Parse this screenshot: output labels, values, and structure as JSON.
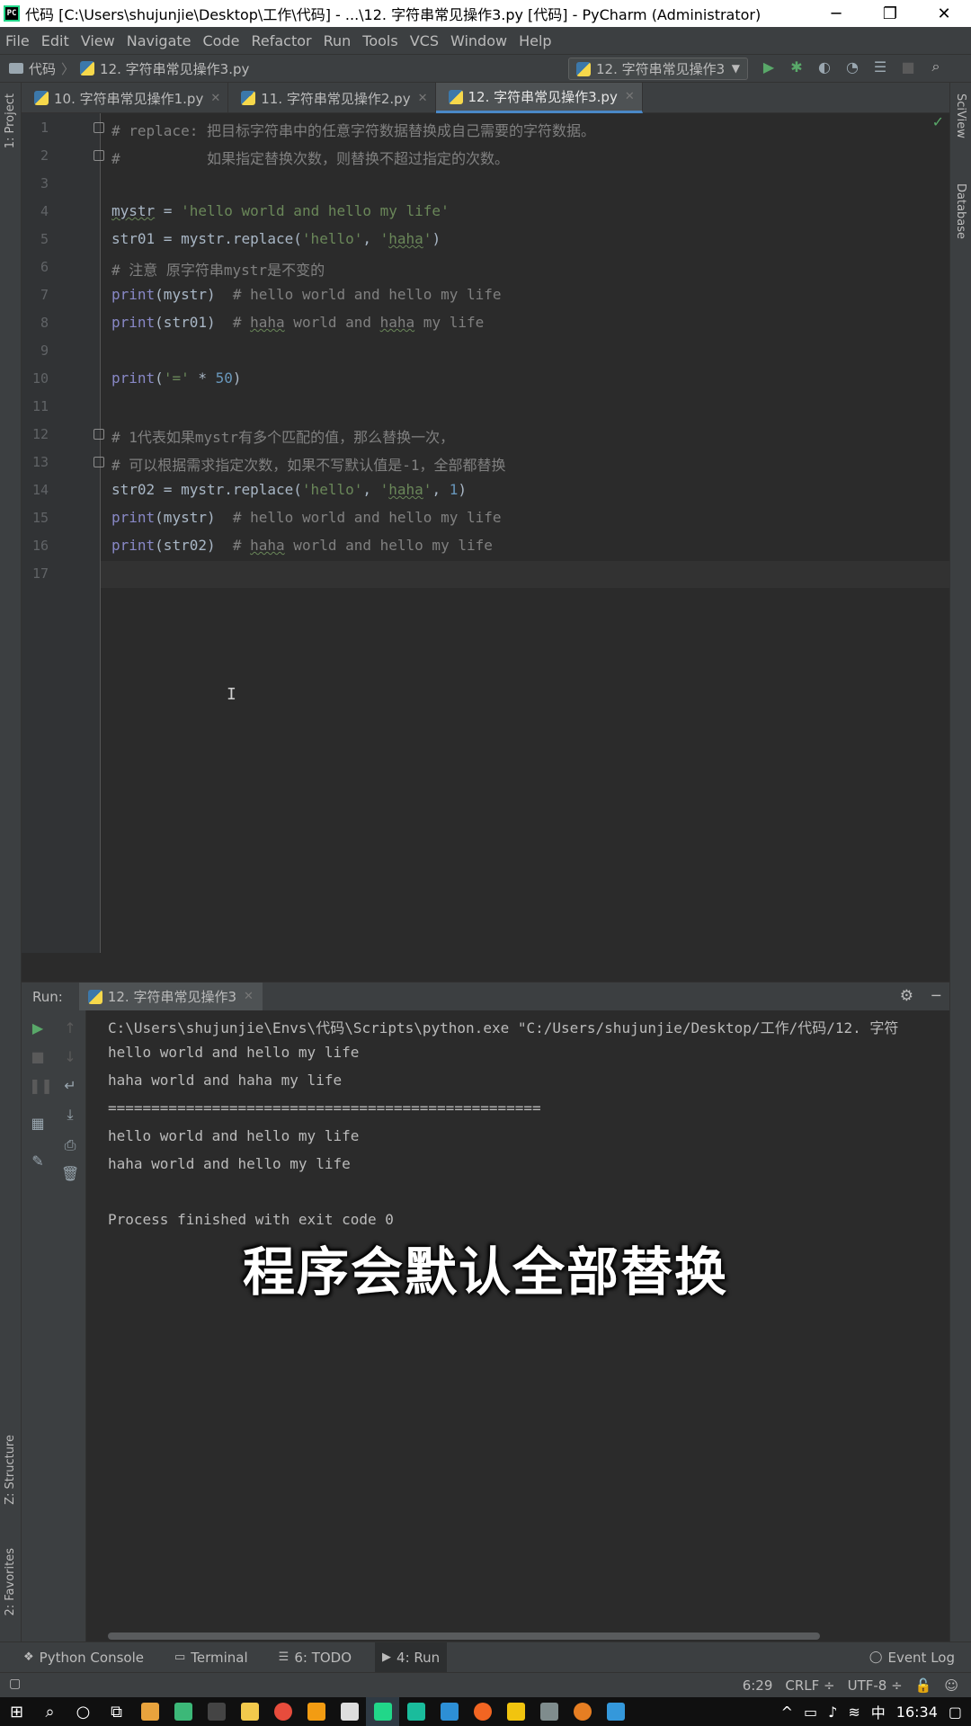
{
  "window": {
    "app_icon": "PC",
    "title": "代码 [C:\\Users\\shujunjie\\Desktop\\工作\\代码] - ...\\12. 字符串常见操作3.py [代码] - PyCharm (Administrator)",
    "minimize": "─",
    "maximize": "❐",
    "close": "✕"
  },
  "menu": [
    "File",
    "Edit",
    "View",
    "Navigate",
    "Code",
    "Refactor",
    "Run",
    "Tools",
    "VCS",
    "Window",
    "Help"
  ],
  "breadcrumb": {
    "project": "代码",
    "file": "12. 字符串常见操作3.py",
    "sep": "〉"
  },
  "run_config": {
    "name": "12. 字符串常见操作3",
    "caret": "▼"
  },
  "toolbar_icons": [
    "play-icon",
    "debug-icon",
    "coverage-icon",
    "profile-icon",
    "build-icon",
    "stop-icon",
    "search-icon"
  ],
  "side_labels": {
    "left_top": "1: Project",
    "left_struct": "Z: Structure",
    "left_fav": "2: Favorites",
    "right_sciview": "SciView",
    "right_db": "Database"
  },
  "tabs": [
    {
      "label": "10. 字符串常见操作1.py",
      "close": "✕"
    },
    {
      "label": "11. 字符串常见操作2.py",
      "close": "✕"
    },
    {
      "label": "12. 字符串常见操作3.py",
      "close": "✕"
    }
  ],
  "editor": {
    "line_numbers": [
      "1",
      "2",
      "3",
      "4",
      "5",
      "6",
      "7",
      "8",
      "9",
      "10",
      "11",
      "12",
      "13",
      "14",
      "15",
      "16",
      "17"
    ],
    "check": "✓",
    "cursor_glyph": "I"
  },
  "code": {
    "l1": "# replace: 把目标字符串中的任意字符数据替换成自己需要的字符数据。",
    "l2": "#          如果指定替换次数，则替换不超过指定的次数。",
    "l4_var": "mystr",
    "l4_eq": " = ",
    "l4_str": "'hello world and hello my life'",
    "l5_pre": "str01 = mystr.replace(",
    "l5_s1": "'hello'",
    "l5_comma": ", ",
    "l5_s2a": "'",
    "l5_s2b": "haha",
    "l5_s2c": "'",
    "l5_close": ")",
    "l6": "# 注意 原字符串mystr是不变的",
    "l7_fn": "print",
    "l7_arg": "(mystr)  ",
    "l7_com": "# hello world and hello my life",
    "l8_fn": "print",
    "l8_arg": "(str01)  ",
    "l8_com_a": "# ",
    "l8_com_b": "haha",
    "l8_com_c": " world and ",
    "l8_com_d": "haha",
    "l8_com_e": " my life",
    "l10_fn": "print",
    "l10_open": "(",
    "l10_str": "'='",
    "l10_mul": " * ",
    "l10_num": "50",
    "l10_close": ")",
    "l12": "# 1代表如果mystr有多个匹配的值，那么替换一次，",
    "l13": "# 可以根据需求指定次数，如果不写默认值是-1，全部都替换",
    "l14_pre": "str02 = mystr.replace(",
    "l14_s1": "'hello'",
    "l14_comma": ", ",
    "l14_s2a": "'",
    "l14_s2b": "haha",
    "l14_s2c": "'",
    "l14_comma2": ", ",
    "l14_num": "1",
    "l14_close": ")",
    "l15_fn": "print",
    "l15_arg": "(mystr)  ",
    "l15_com": "# hello world and hello my life",
    "l16_fn": "print",
    "l16_arg": "(str02)  ",
    "l16_com_a": "# ",
    "l16_com_b": "haha",
    "l16_com_c": " world and hello my life"
  },
  "run_panel": {
    "label": "Run:",
    "tab": "12. 字符串常见操作3",
    "tab_close": "✕",
    "gear": "⚙",
    "minimize": "─"
  },
  "console": [
    "C:\\Users\\shujunjie\\Envs\\代码\\Scripts\\python.exe \"C:/Users/shujunjie/Desktop/工作/代码/12. 字符",
    "hello world and hello my life",
    "haha world and haha my life",
    "==================================================",
    "hello world and hello my life",
    "haha world and hello my life",
    "",
    "Process finished with exit code 0"
  ],
  "subtitle": "程序会默认全部替换",
  "bottom_tools": [
    {
      "label": "Python Console",
      "icon": "python-console-icon"
    },
    {
      "label": "Terminal",
      "icon": "terminal-icon"
    },
    {
      "label": "6: TODO",
      "icon": "todo-icon"
    },
    {
      "label": "4: Run",
      "icon": "run-icon"
    }
  ],
  "event_log": "Event Log",
  "status": {
    "position": "6:29",
    "line_sep": "CRLF ÷",
    "encoding": "UTF-8 ÷"
  },
  "taskbar": {
    "ime": "中",
    "time": "16:34"
  }
}
